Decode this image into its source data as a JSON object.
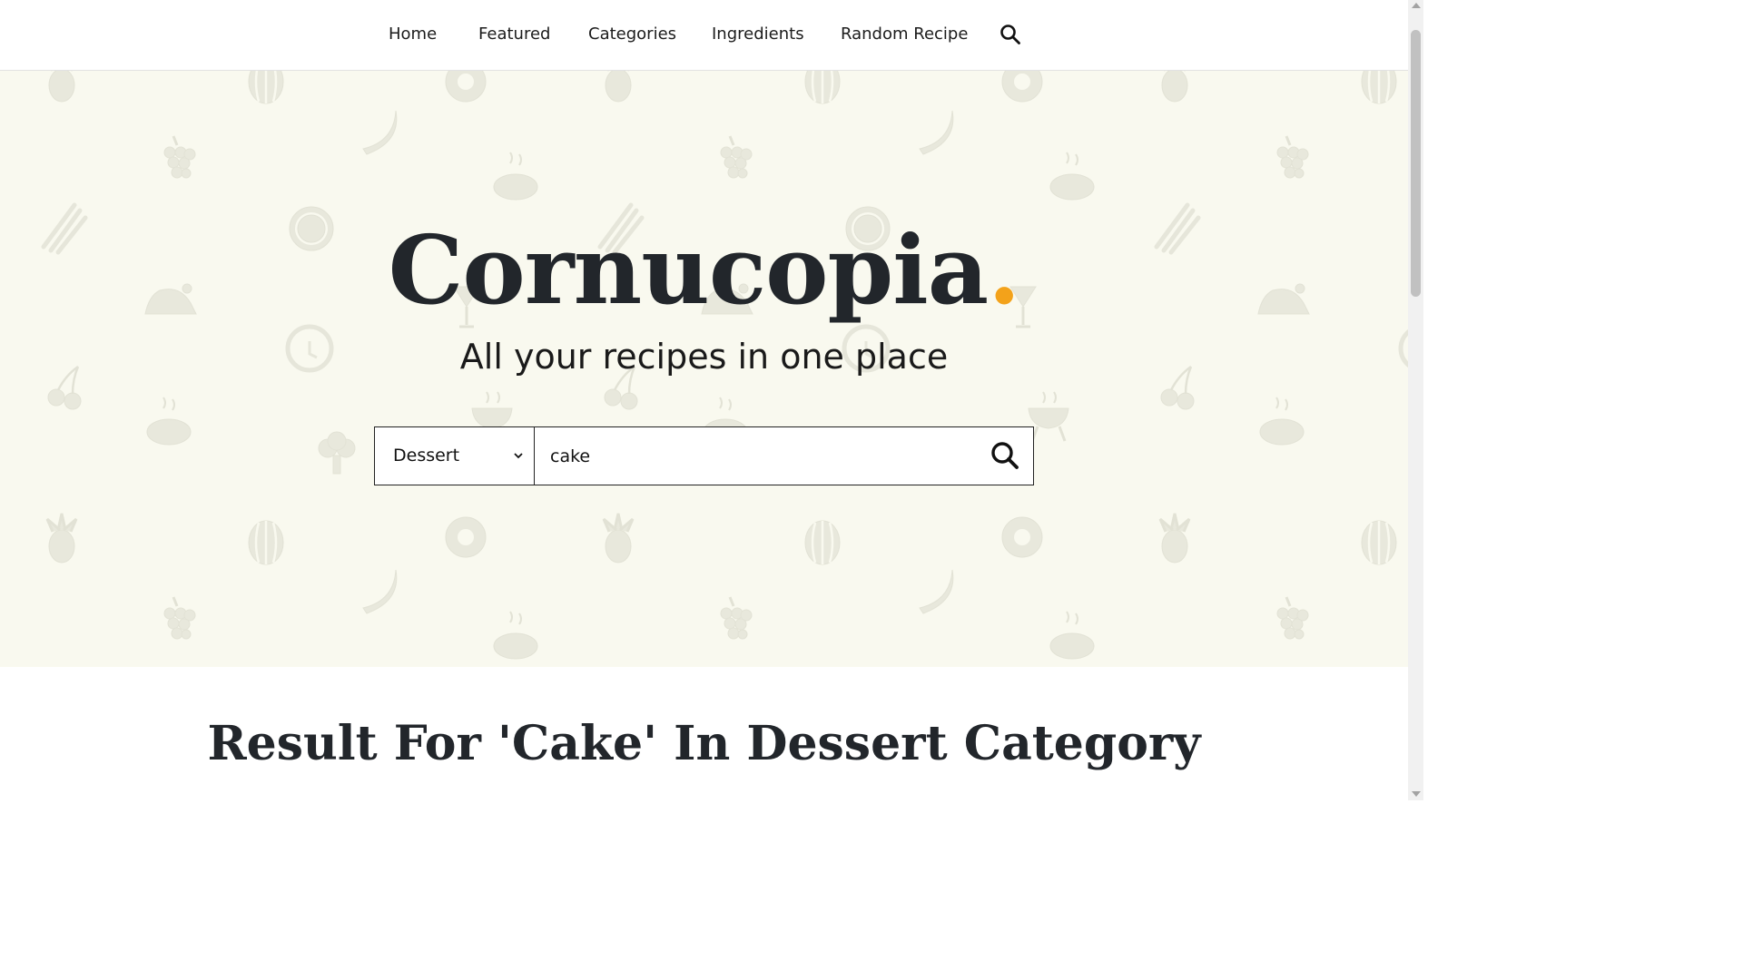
{
  "nav": {
    "items": [
      {
        "label": "Home"
      },
      {
        "label": "Featured"
      },
      {
        "label": "Categories"
      },
      {
        "label": "Ingredients"
      },
      {
        "label": "Random Recipe"
      }
    ],
    "search_icon": "search-icon"
  },
  "hero": {
    "brand": "Cornucopia",
    "brand_dot": ".",
    "tagline": "All your recipes in one place",
    "pattern_icons": [
      "pineapple-icon",
      "watermelon-icon",
      "donut-icon",
      "banana-icon",
      "grapes-icon",
      "steak-icon",
      "asparagus-icon",
      "orange-slice-icon",
      "roast-chicken-icon",
      "cocktail-icon",
      "pizza-icon",
      "cherry-icon",
      "grill-icon",
      "broccoli-icon"
    ]
  },
  "search": {
    "category_selected": "Dessert",
    "query_value": "cake",
    "query_placeholder": ""
  },
  "results": {
    "title": "Result For 'Cake' In Dessert Category"
  },
  "colors": {
    "accent": "#f3a21a",
    "hero_bg": "#f9f9ef",
    "text_dark": "#22262b"
  }
}
